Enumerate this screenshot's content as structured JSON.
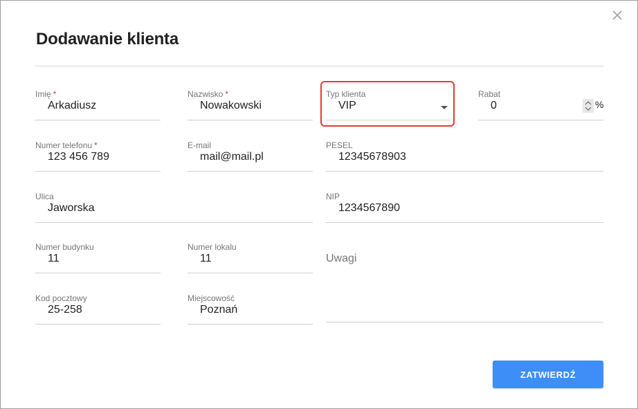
{
  "dialog": {
    "title": "Dodawanie klienta",
    "close_icon": "close-icon"
  },
  "form": {
    "first_name": {
      "label": "Imię",
      "required_mark": "*",
      "value": "Arkadiusz"
    },
    "last_name": {
      "label": "Nazwisko",
      "required_mark": "*",
      "value": "Nowakowski"
    },
    "client_type": {
      "label": "Typ klienta",
      "value": "VIP",
      "icon": "dropdown-caret-icon"
    },
    "discount": {
      "label": "Rabat",
      "value": "0",
      "unit": "%",
      "icon": "spinner-icon"
    },
    "phone": {
      "label": "Numer telefonu",
      "required_mark": "*",
      "value": "123 456 789"
    },
    "email": {
      "label": "E-mail",
      "value": "mail@mail.pl"
    },
    "pesel": {
      "label": "PESEL",
      "value": "12345678903"
    },
    "street": {
      "label": "Ulica",
      "value": "Jaworska"
    },
    "nip": {
      "label": "NIP",
      "value": "1234567890"
    },
    "building_number": {
      "label": "Numer budynku",
      "value": "11"
    },
    "apartment_number": {
      "label": "Numer lokalu",
      "value": "11"
    },
    "notes": {
      "label": "Uwagi",
      "value": ""
    },
    "postal_code": {
      "label": "Kod pocztowy",
      "value": "25-258"
    },
    "city": {
      "label": "Miejscowość",
      "value": "Poznań"
    }
  },
  "actions": {
    "submit_label": "ZATWIERDŹ"
  },
  "colors": {
    "primary": "#3e8ef7",
    "required": "#e53935",
    "highlight": "#e53935"
  }
}
